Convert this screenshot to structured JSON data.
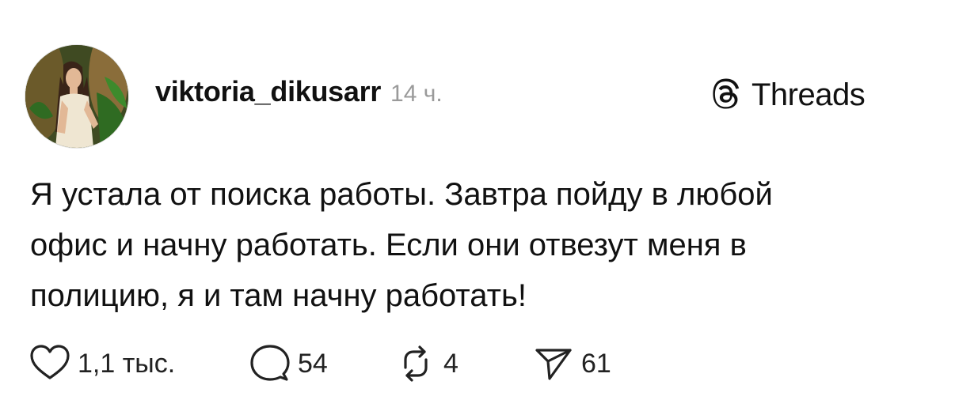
{
  "post": {
    "author": {
      "username": "viktoria_dikusarr",
      "avatar_alt": "profile photo"
    },
    "timestamp": "14 ч.",
    "brand": {
      "name": "Threads",
      "icon": "threads-logo-icon"
    },
    "text_lines": [
      "Я устала от поиска работы. Завтра пойду в любой",
      "офис и начну работать. Если они отвезут меня в",
      "полицию, я и там начну работать!"
    ],
    "actions": {
      "likes": {
        "icon": "heart-icon",
        "count": "1,1 тыс."
      },
      "replies": {
        "icon": "comment-icon",
        "count": "54"
      },
      "reposts": {
        "icon": "repost-icon",
        "count": "4"
      },
      "shares": {
        "icon": "send-icon",
        "count": "61"
      }
    }
  },
  "colors": {
    "text": "#111111",
    "muted": "#9a9a9a",
    "background": "#ffffff"
  }
}
